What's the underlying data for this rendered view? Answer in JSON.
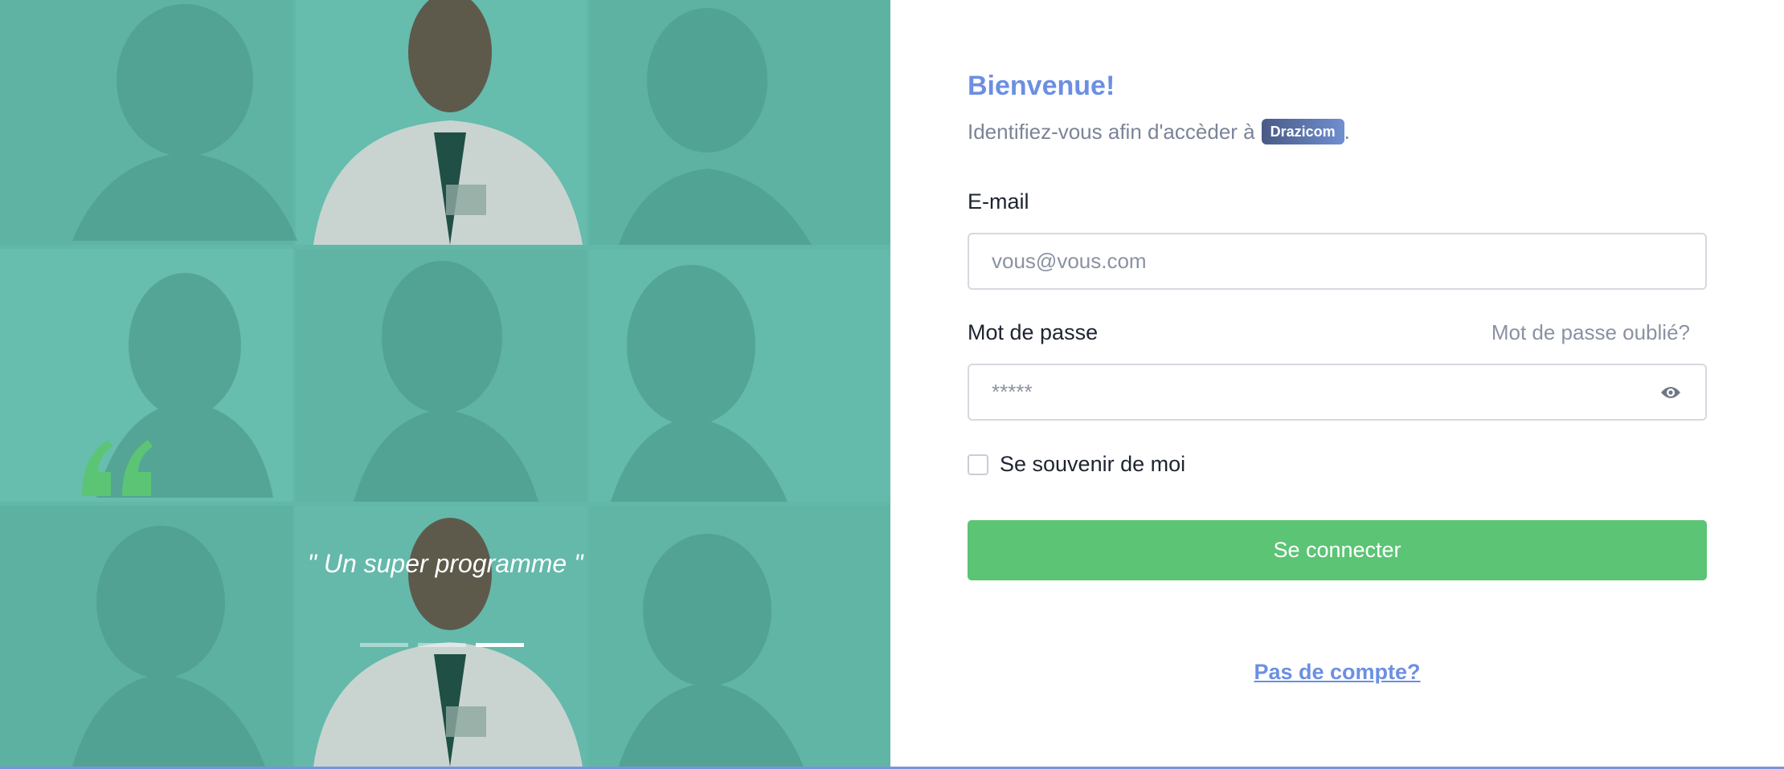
{
  "hero": {
    "quote": "\" Un super programme \"",
    "carousel": {
      "slides": 3,
      "active_index": 2
    }
  },
  "login": {
    "title": "Bienvenue!",
    "subtitle_prefix": "Identifiez-vous afin d'accèder à",
    "brand": "Drazicom",
    "subtitle_suffix": ".",
    "email_label": "E-mail",
    "email_placeholder": "vous@vous.com",
    "password_label": "Mot de passe",
    "forgot_link": "Mot de passe oublié?",
    "password_placeholder": "*****",
    "remember_label": "Se souvenir de moi",
    "remember_checked": false,
    "submit_label": "Se connecter",
    "signup_link": "Pas de compte?"
  },
  "colors": {
    "accent": "#6c8fe3",
    "button": "#5cc475",
    "hero_bg": "#63b9a9"
  },
  "icons": {
    "quote": "quote-icon",
    "password_toggle": "eye-icon"
  }
}
